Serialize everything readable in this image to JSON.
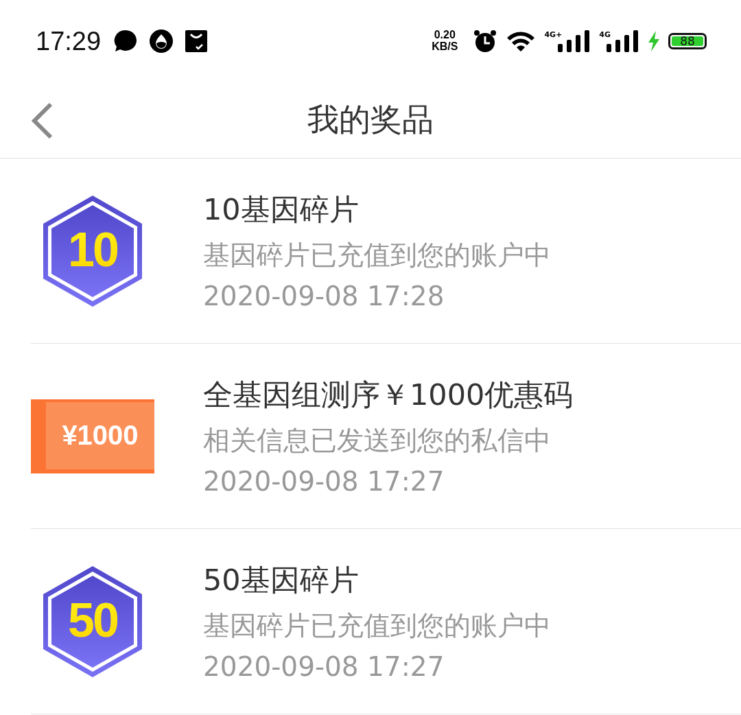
{
  "status_bar": {
    "time": "17:29",
    "net_speed": "0.20",
    "net_unit": "KB/S",
    "signal_1_label": "4G+",
    "signal_2_label": "4G",
    "battery": "88"
  },
  "header": {
    "title": "我的奖品"
  },
  "prizes": [
    {
      "kind": "hexagon",
      "badge": "10",
      "title": "10基因碎片",
      "description": "基因碎片已充值到您的账户中",
      "time": "2020-09-08 17:28"
    },
    {
      "kind": "coupon",
      "badge": "¥1000",
      "title": "全基因组测序￥1000优惠码",
      "description": "相关信息已发送到您的私信中",
      "time": "2020-09-08 17:27"
    },
    {
      "kind": "hexagon",
      "badge": "50",
      "title": "50基因碎片",
      "description": "基因碎片已充值到您的账户中",
      "time": "2020-09-08 17:27"
    }
  ]
}
